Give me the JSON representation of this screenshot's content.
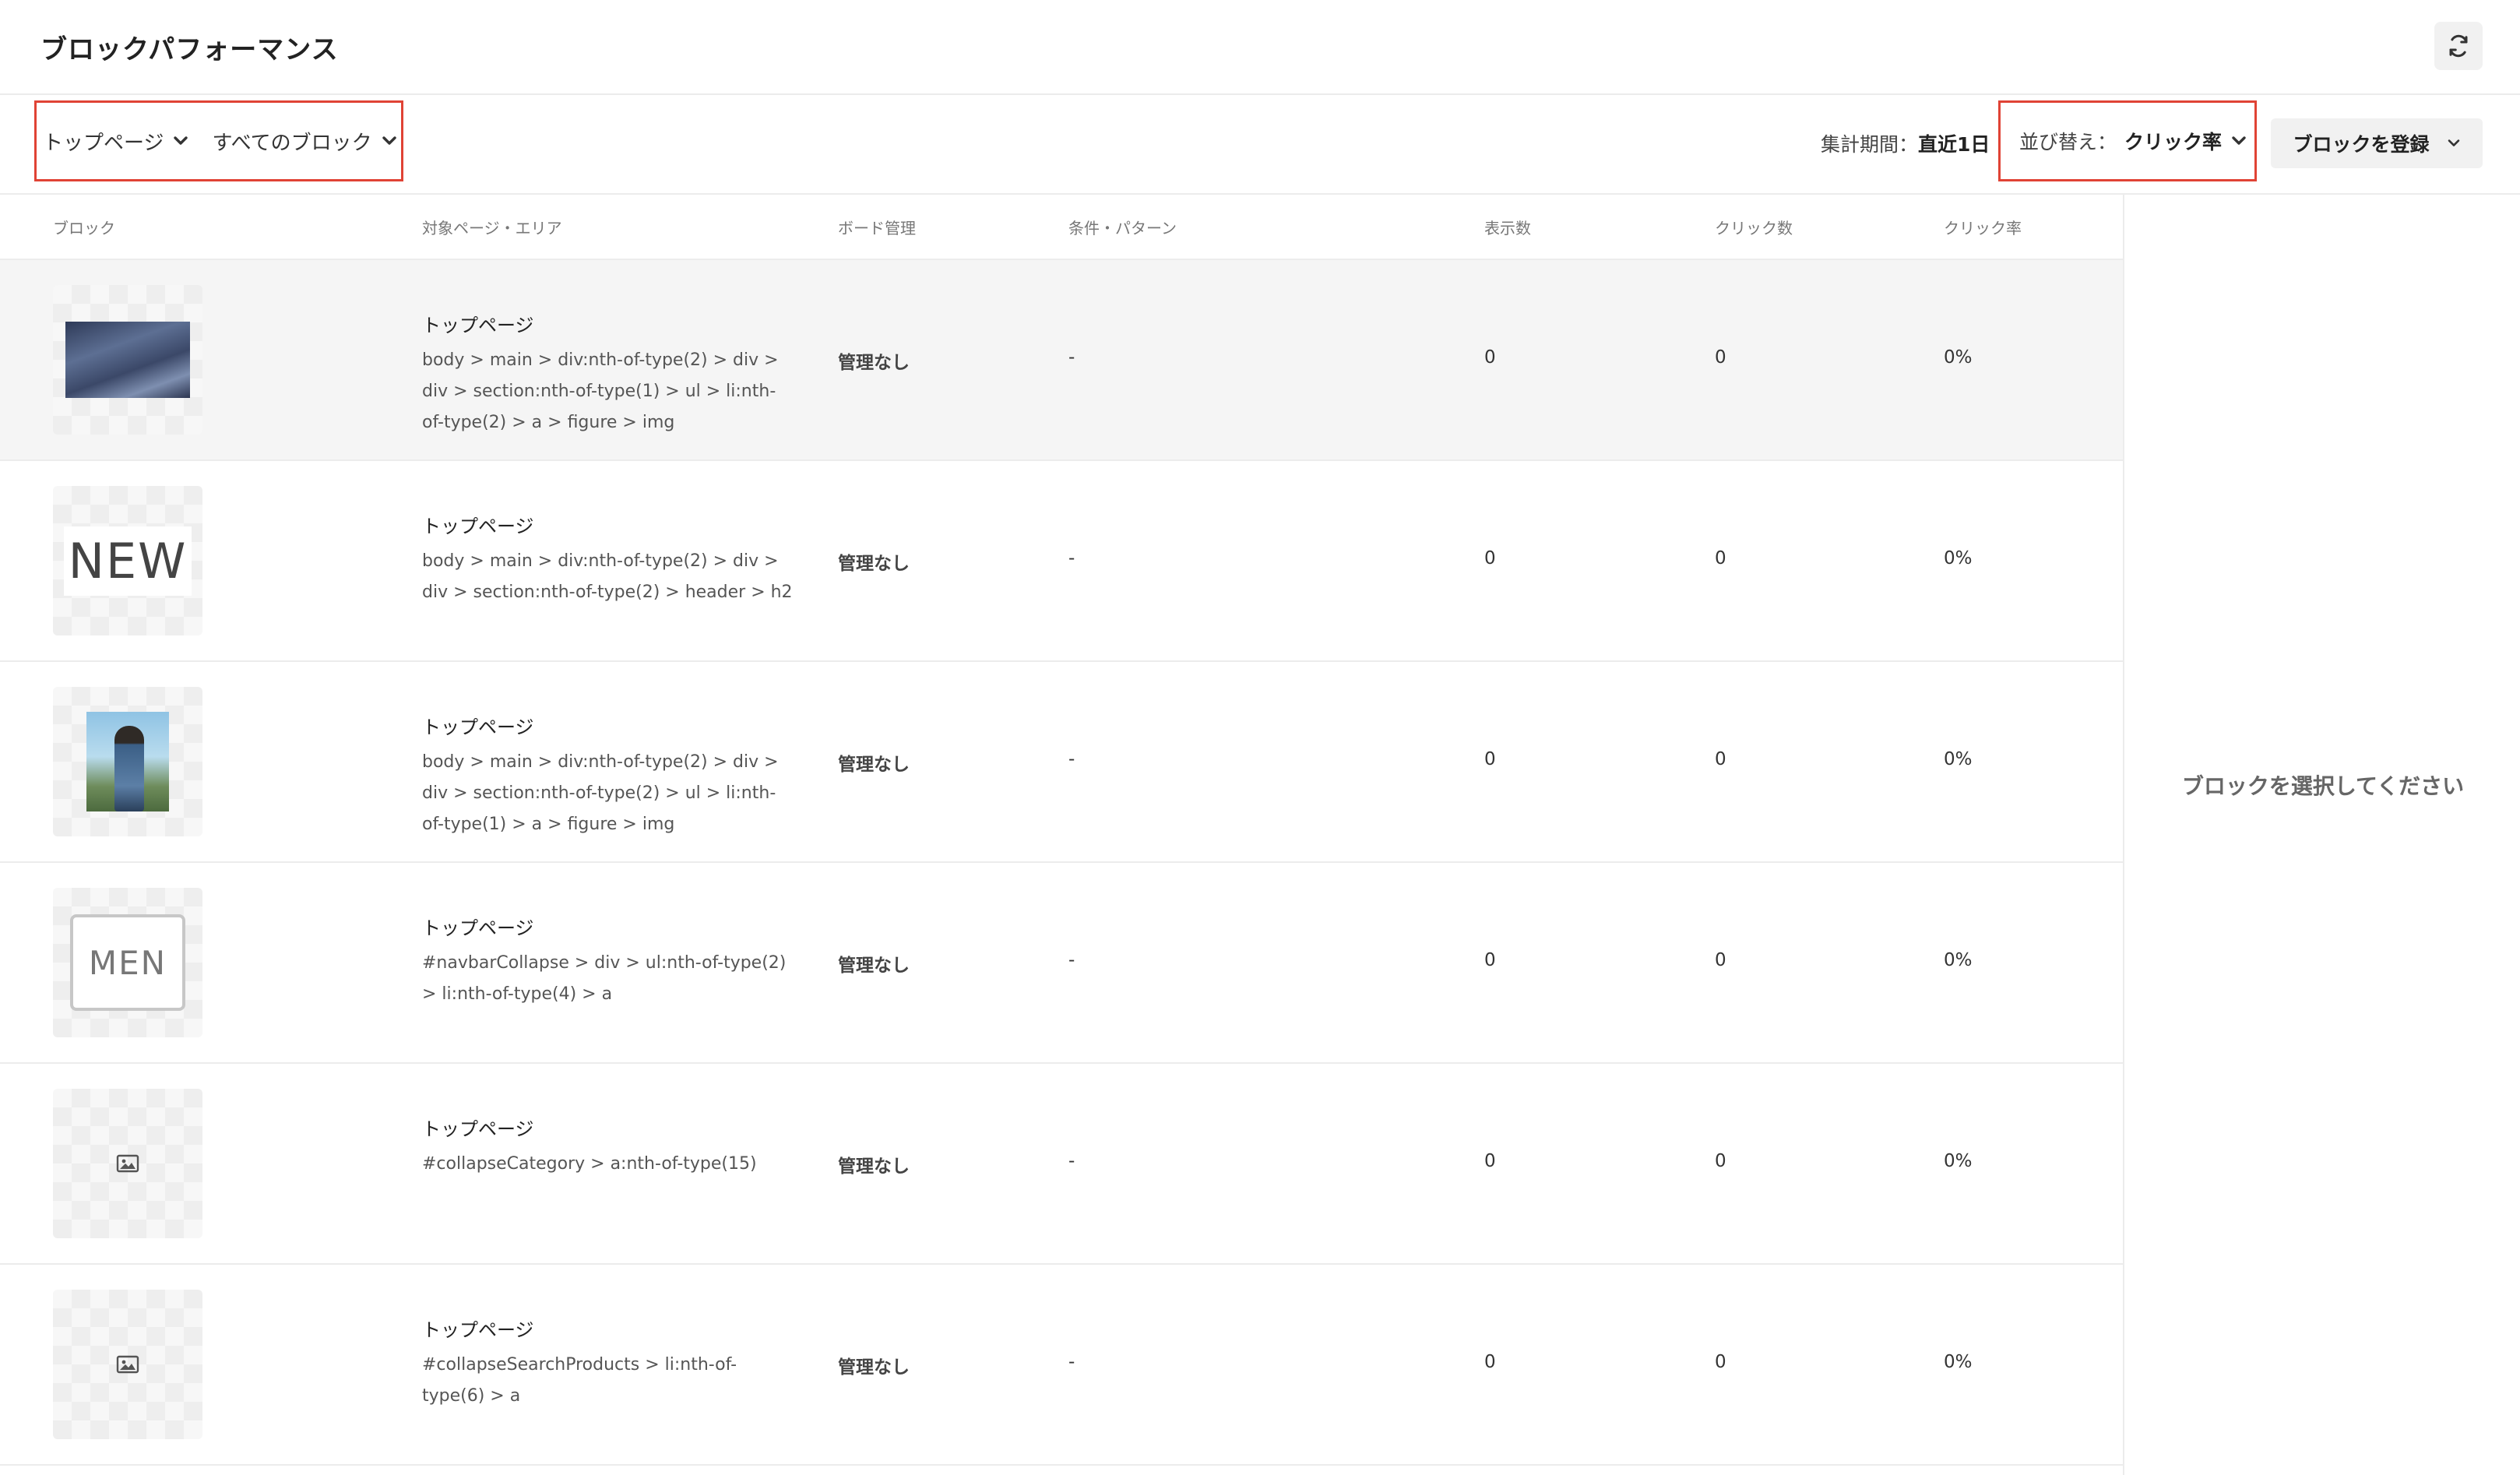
{
  "header": {
    "title": "ブロックパフォーマンス",
    "refresh_icon": "refresh-icon"
  },
  "toolbar": {
    "page_filter": "トップページ",
    "block_filter": "すべてのブロック",
    "period_label": "集計期間：",
    "period_value": "直近1日",
    "sort_label": "並び替え：",
    "sort_value": "クリック率",
    "register_label": "ブロックを登録"
  },
  "table": {
    "columns": {
      "block": "ブロック",
      "target": "対象ページ・エリア",
      "board": "ボード管理",
      "condition": "条件・パターン",
      "views": "表示数",
      "clicks": "クリック数",
      "ctr": "クリック率"
    },
    "rows": [
      {
        "thumbnail": "jacket-photo",
        "page": "トップページ",
        "path": "body > main > div:nth-of-type(2) > div > div > section:nth-of-type(1) > ul > li:nth-of-type(2) > a > figure > img",
        "board": "管理なし",
        "condition": "-",
        "views": "0",
        "clicks": "0",
        "ctr": "0%"
      },
      {
        "thumbnail": "new-text",
        "thumbnail_text": "NEW",
        "page": "トップページ",
        "path": "body > main > div:nth-of-type(2) > div > div > section:nth-of-type(2) > header > h2",
        "board": "管理なし",
        "condition": "-",
        "views": "0",
        "clicks": "0",
        "ctr": "0%"
      },
      {
        "thumbnail": "man-photo",
        "page": "トップページ",
        "path": "body > main > div:nth-of-type(2) > div > div > section:nth-of-type(2) > ul > li:nth-of-type(1) > a > figure > img",
        "board": "管理なし",
        "condition": "-",
        "views": "0",
        "clicks": "0",
        "ctr": "0%"
      },
      {
        "thumbnail": "men-button",
        "thumbnail_text": "MEN",
        "page": "トップページ",
        "path": "#navbarCollapse > div > ul:nth-of-type(2) > li:nth-of-type(4) > a",
        "board": "管理なし",
        "condition": "-",
        "views": "0",
        "clicks": "0",
        "ctr": "0%"
      },
      {
        "thumbnail": "image-placeholder-icon",
        "page": "トップページ",
        "path": "#collapseCategory > a:nth-of-type(15)",
        "board": "管理なし",
        "condition": "-",
        "views": "0",
        "clicks": "0",
        "ctr": "0%"
      },
      {
        "thumbnail": "image-placeholder-icon",
        "page": "トップページ",
        "path": "#collapseSearchProducts > li:nth-of-type(6) > a",
        "board": "管理なし",
        "condition": "-",
        "views": "0",
        "clicks": "0",
        "ctr": "0%"
      }
    ]
  },
  "side_panel": {
    "message": "ブロックを選択してください"
  },
  "colors": {
    "highlight_border": "#e04335",
    "button_bg": "#f1f1f1",
    "selected_row_bg": "#f5f5f5",
    "divider": "#ececec"
  }
}
